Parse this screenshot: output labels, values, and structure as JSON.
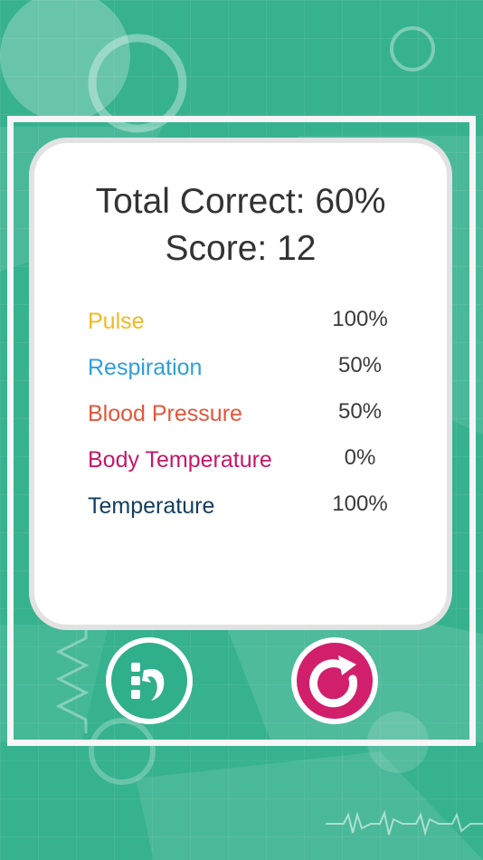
{
  "results": {
    "total_correct": "Total Correct: 60%",
    "score": "Score: 12"
  },
  "categories": [
    {
      "label": "Pulse",
      "percent": "100%",
      "color": "#f2b91f"
    },
    {
      "label": "Respiration",
      "percent": "50%",
      "color": "#2d9fd8"
    },
    {
      "label": "Blood Pressure",
      "percent": "50%",
      "color": "#e4563b"
    },
    {
      "label": "Body Temperature",
      "percent": "0%",
      "color": "#c4186a"
    },
    {
      "label": "Temperature",
      "percent": "100%",
      "color": "#123d5c"
    }
  ],
  "buttons": {
    "menu_icon": "list-back-icon",
    "retry_icon": "retry-icon"
  },
  "colors": {
    "background": "#36b28e",
    "menu_button": "#2faf8a",
    "retry_button": "#d21f6c"
  }
}
